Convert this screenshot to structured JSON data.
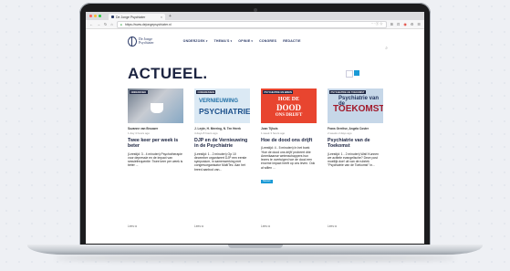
{
  "browser": {
    "tab_title": "De Jonge Psychiater",
    "tab_close": "×",
    "new_tab": "+",
    "nav_buttons": [
      "←",
      "→",
      "↻",
      "⌂"
    ],
    "url": "https://www.dejongepsychiater.nl",
    "url_more": "··· ⓥ ☆",
    "toolbar_icons": [
      "⊞",
      "⊡",
      "◉",
      "⚙",
      "☰"
    ]
  },
  "site": {
    "logo_line1": "De Jonge",
    "logo_line2": "Psychiater",
    "nav": [
      {
        "label": "ONDERZOEK",
        "caret": "▾"
      },
      {
        "label": "THEMA'S",
        "caret": "▾"
      },
      {
        "label": "OPINIE",
        "caret": "▾"
      },
      {
        "label": "CONGRES",
        "caret": ""
      },
      {
        "label": "REDACTIE",
        "caret": ""
      }
    ],
    "search_icon": "⌕"
  },
  "page": {
    "title": "ACTUEEL."
  },
  "cards": [
    {
      "badge": "ONDERZOEK",
      "author": "Suzanne van Brouwer",
      "date": "1 day 4 hours ago",
      "title": "Twee keer per week is beter",
      "excerpt": "(Leestijd: 3 - 4 minuten) Psychotherapie voor depressie en de impact van sessiefrequentie: Twee keer per week is beter ...",
      "readmore": "Lees ⧉"
    },
    {
      "badge": "CONGRESSEN",
      "image_line1": "VERNIEUWING",
      "image_line2": "PSYCHIATRIE",
      "author": "J. Leyte, H. Meering, N. Ten Heerk",
      "date": "4 days 8 hours ago",
      "title": "DJP en de Vernieuwing in de Psychiatrie",
      "excerpt": "(Leestijd: 1 - 2 minuten) Op 10 december organiseert DJP een eerste symposium, in samenwerking met congresorganisator MultiTec. Aan het breed aanbod van...",
      "readmore": "Lees ⧉"
    },
    {
      "badge": "PSYCHIATRIE EN BREIN",
      "image_line1": "HOE DE",
      "image_line2": "DOOD",
      "image_line3": "ONS DRIJFT",
      "author": "Joan Tijhuis",
      "date": "1 week 3 hours ago",
      "title": "Hoe de dood ons drijft",
      "excerpt": "(Leestijd: 4 - 5 minuten) In het boek 'Hoe de dood ons drijft' probeert drie Amerikaanse wetenschappers hun lezers te overtuigen hoe de dood een enorme impact heeft op ons leven. Ook al willen ...",
      "tag": "Nieuws",
      "readmore": "Lees ⧉"
    },
    {
      "badge": "PSYCHIATRIE EN TOEKOMST",
      "image_line1": "Psychiatrie van de",
      "image_line2": "TOEKOMST",
      "author": "Frans Gerritse, Angela Coster",
      "date": "2 weeks 2 days ago",
      "title": "Psychiatrie van de Toekomst",
      "excerpt": "(Leestijd: 1 - 2 minuten) Wat! Kunnen we actitele evangelische? Deze post moeilijk doe! uit van de rubriek \"Psychiatrie van de Toekomst\" in...",
      "readmore": "Lees ⧉"
    }
  ]
}
